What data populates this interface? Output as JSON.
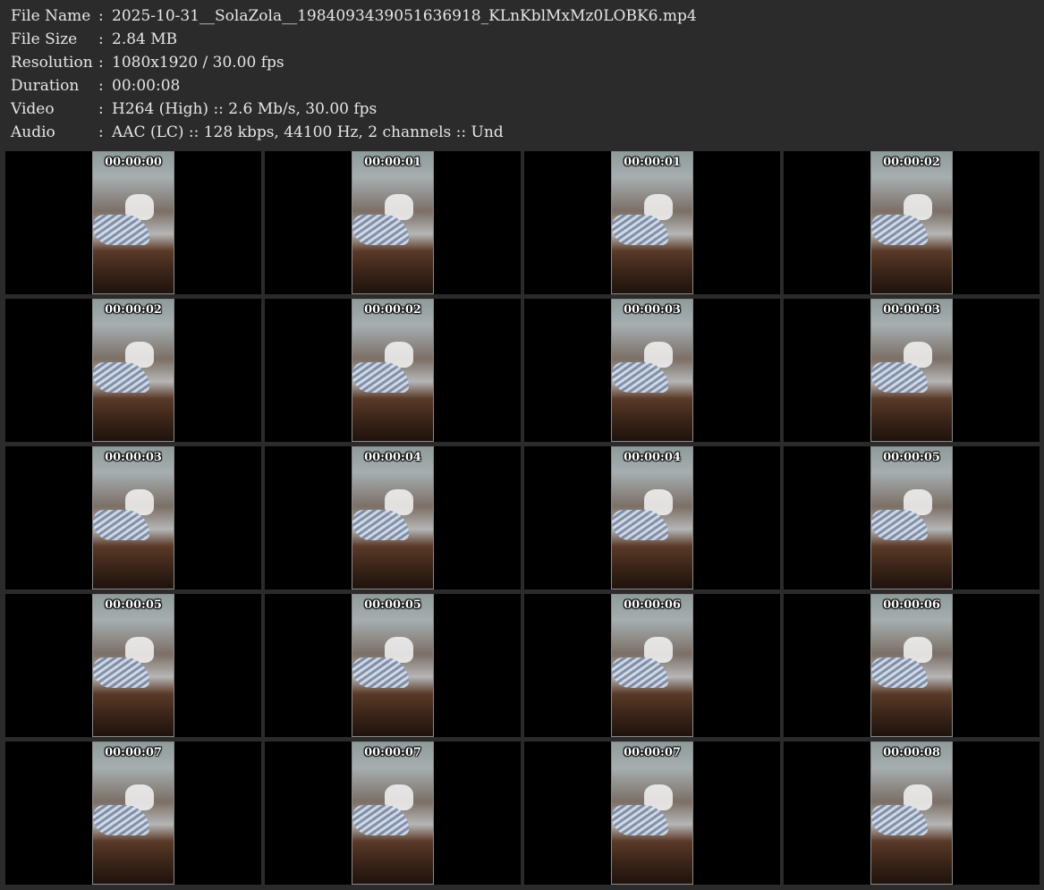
{
  "info": {
    "rows": [
      {
        "label": "File Name",
        "value": "2025-10-31__SolaZola__1984093439051636918_KLnKblMxMz0LOBK6.mp4"
      },
      {
        "label": "File Size",
        "value": "2.84 MB"
      },
      {
        "label": "Resolution",
        "value": "1080x1920 / 30.00 fps"
      },
      {
        "label": "Duration",
        "value": "00:00:08"
      },
      {
        "label": "Video",
        "value": "H264 (High) :: 2.6 Mb/s, 30.00 fps"
      },
      {
        "label": "Audio",
        "value": "AAC (LC) :: 128 kbps, 44100 Hz, 2 channels :: Und"
      }
    ],
    "separator": ":"
  },
  "thumbnails": [
    "00:00:00",
    "00:00:01",
    "00:00:01",
    "00:00:02",
    "00:00:02",
    "00:00:02",
    "00:00:03",
    "00:00:03",
    "00:00:03",
    "00:00:04",
    "00:00:04",
    "00:00:05",
    "00:00:05",
    "00:00:05",
    "00:00:06",
    "00:00:06",
    "00:00:07",
    "00:00:07",
    "00:00:07",
    "00:00:08"
  ],
  "colors": {
    "background": "#2b2b2b",
    "text": "#e6e6e6",
    "cell": "#000000"
  }
}
